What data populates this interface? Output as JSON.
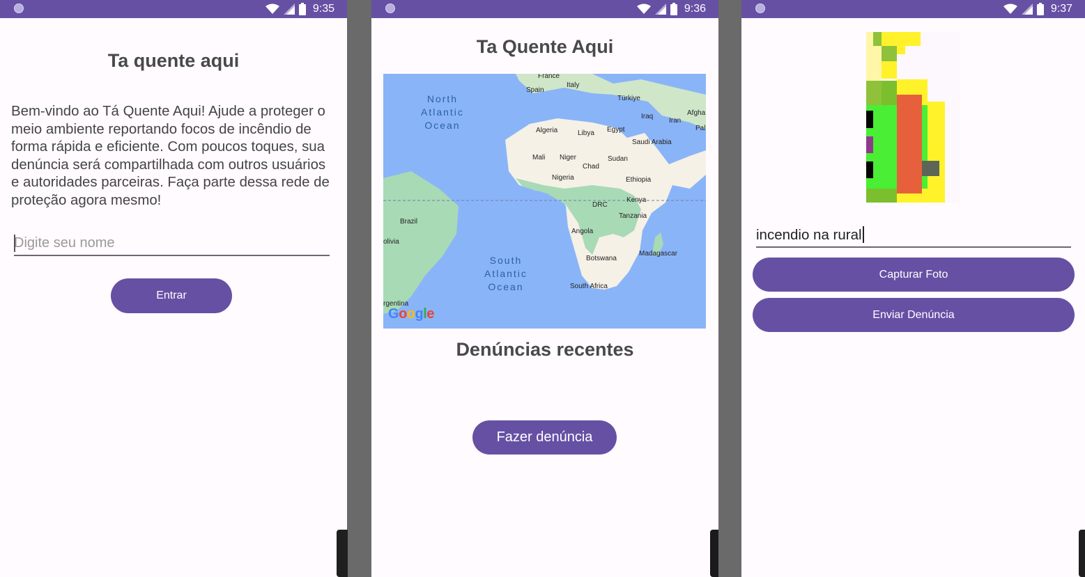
{
  "colors": {
    "primary": "#6650a4",
    "surface": "#fffbfe",
    "gutter": "#6a6a6a",
    "ocean": "#8ab4f8",
    "land": "#f5f1e6",
    "vegetation": "#a8dab5"
  },
  "screen_login": {
    "status_time": "9:35",
    "title": "Ta quente aqui",
    "welcome_text": "Bem-vindo ao Tá Quente Aqui! Ajude a proteger o meio ambiente reportando focos de incêndio de forma rápida e eficiente. Com poucos toques, sua denúncia será compartilhada com outros usuários e autoridades parceiras. Faça parte dessa rede de proteção agora mesmo!",
    "name_placeholder": "Digite seu nome",
    "enter_label": "Entrar"
  },
  "screen_home": {
    "status_time": "9:36",
    "title": "Ta Quente Aqui",
    "map": {
      "logo": "Google",
      "oceans": [
        "North\nAtlantic\nOcean",
        "South\nAtlantic\nOcean"
      ],
      "countries": [
        "France",
        "Spain",
        "Italy",
        "Türkiye",
        "Afgha",
        "Iraq",
        "Iran",
        "Pal",
        "Algeria",
        "Libya",
        "Egypt",
        "Saudi Arabia",
        "Mali",
        "Niger",
        "Chad",
        "Sudan",
        "Nigeria",
        "Ethiopia",
        "DRC",
        "Kenya",
        "Tanzania",
        "Brazil",
        "olivia",
        "Angola",
        "Madagascar",
        "Botswana",
        "South Africa",
        "rgentina"
      ]
    },
    "section_title": "Denúncias recentes",
    "report_button_label": "Fazer denúncia"
  },
  "screen_report": {
    "status_time": "9:37",
    "description_value": "incendio na rural",
    "capture_button_label": "Capturar Foto",
    "send_button_label": "Enviar Denúncia"
  },
  "icons": [
    "status-dot-icon",
    "wifi-icon",
    "signal-icon",
    "battery-icon"
  ]
}
